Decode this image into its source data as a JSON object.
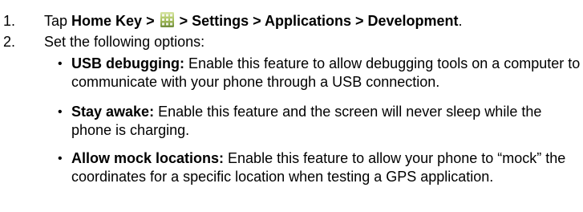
{
  "steps": [
    {
      "number": "1.",
      "prefix": "Tap ",
      "home_key": "Home Key >",
      "after_icon": " > Settings > Applications > Development",
      "end": "."
    },
    {
      "number": "2.",
      "text": "Set the following options:"
    }
  ],
  "options": [
    {
      "bullet": "•",
      "title": "USB debugging:",
      "description": " Enable this feature to allow debugging tools on a computer to communicate with your phone through a USB connection."
    },
    {
      "bullet": "•",
      "title": "Stay awake:",
      "description": " Enable this feature and the screen will never sleep while the phone is charging."
    },
    {
      "bullet": "•",
      "title": "Allow mock locations:",
      "description": " Enable this feature to allow your phone to “mock” the coordinates for a specific location when testing a GPS application."
    }
  ],
  "icons": {
    "applications": "applications-grid-icon",
    "applications_colors": [
      "#6e8a3a",
      "#a9c25e",
      "#d8e6a6"
    ]
  }
}
